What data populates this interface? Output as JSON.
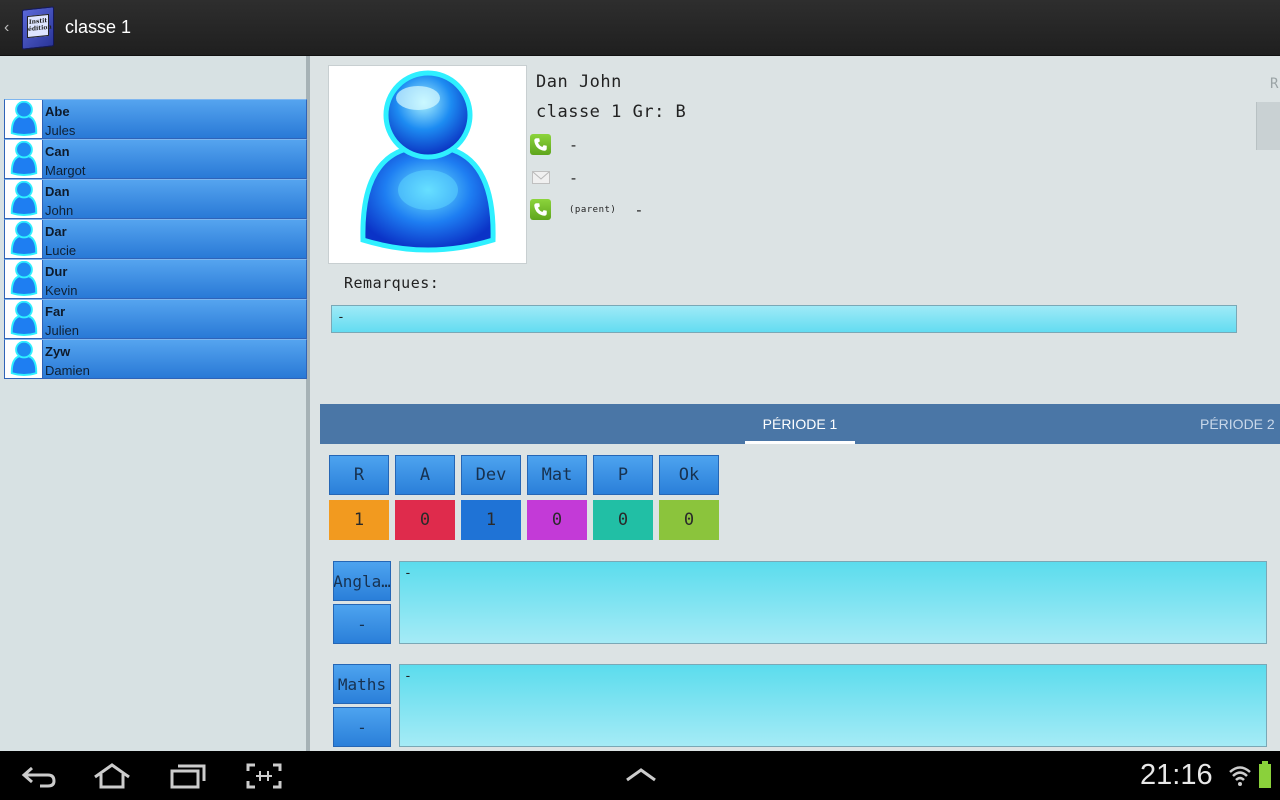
{
  "app": {
    "title": "classe 1",
    "icon_name": "book-app-icon",
    "icon_text": "Instit édition"
  },
  "students": [
    {
      "last": "Abe",
      "first": "Jules"
    },
    {
      "last": "Can",
      "first": "Margot"
    },
    {
      "last": "Dan",
      "first": "John"
    },
    {
      "last": "Dar",
      "first": "Lucie"
    },
    {
      "last": "Dur",
      "first": "Kevin"
    },
    {
      "last": "Far",
      "first": "Julien"
    },
    {
      "last": "Zyw",
      "first": "Damien"
    }
  ],
  "detail": {
    "name": "Dan John",
    "class_group": "classe 1 Gr: B",
    "phone": "-",
    "email": "-",
    "parent_label": "(parent)",
    "parent_phone": "-",
    "remarks_label": "Remarques:",
    "remarks_value": "-",
    "edge_letter": "R"
  },
  "tabs": [
    {
      "label": "PÉRIODE 1",
      "active": true
    },
    {
      "label": "PÉRIODE 2",
      "active": false
    }
  ],
  "counters": [
    {
      "label": "R",
      "value": "1",
      "color": "#f29a1f"
    },
    {
      "label": "A",
      "value": "0",
      "color": "#df2b4c"
    },
    {
      "label": "Dev",
      "value": "1",
      "color": "#1f73d6"
    },
    {
      "label": "Mat",
      "value": "0",
      "color": "#c33ad7"
    },
    {
      "label": "P",
      "value": "0",
      "color": "#21bfa5"
    },
    {
      "label": "Ok",
      "value": "0",
      "color": "#8bc43c"
    }
  ],
  "subjects": [
    {
      "name": "Angla…",
      "grade": "-",
      "note": "-"
    },
    {
      "name": "Maths",
      "grade": "-",
      "note": "-"
    }
  ],
  "status": {
    "time": "21:16"
  }
}
